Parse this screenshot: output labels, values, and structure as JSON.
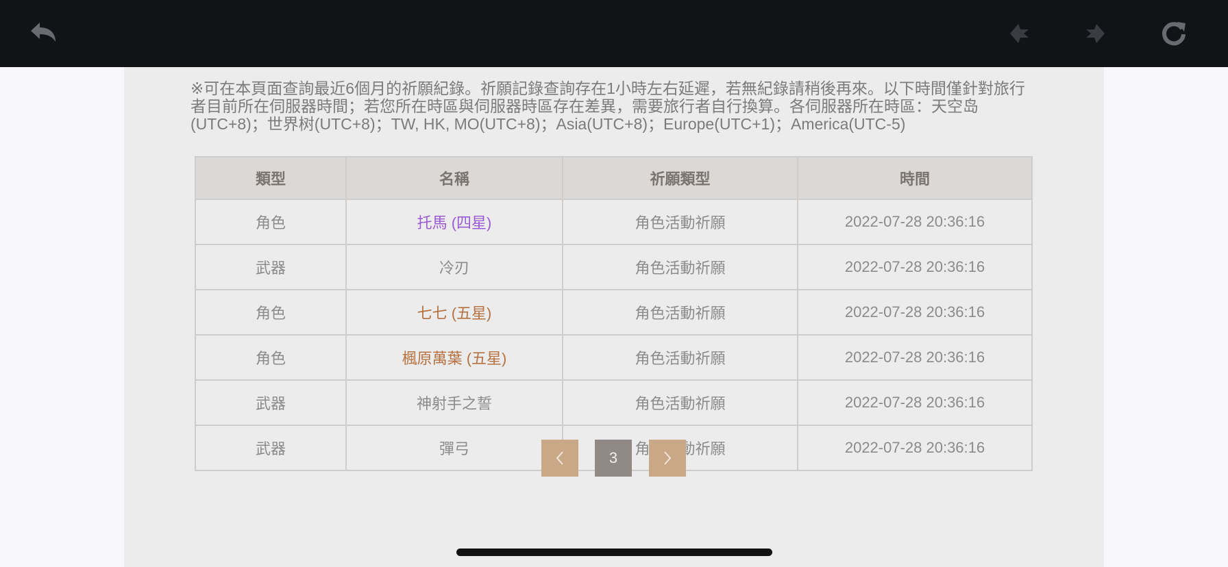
{
  "topbar": {
    "back_icon": "undo-arrow-icon",
    "prev_icon": "diamond-left-icon",
    "next_icon": "diamond-right-icon",
    "refresh_icon": "refresh-icon"
  },
  "notice": "※可在本頁面查詢最近6個月的祈願紀錄。祈願記錄查詢存在1小時左右延遲，若無紀錄請稍後再來。以下時間僅針對旅行者目前所在伺服器時間；若您所在時區與伺服器時區存在差異，需要旅行者自行換算。各伺服器所在時區：天空岛(UTC+8)；世界树(UTC+8)；TW, HK, MO(UTC+8)；Asia(UTC+8)；Europe(UTC+1)；America(UTC-5)",
  "table": {
    "headers": [
      "類型",
      "名稱",
      "祈願類型",
      "時間"
    ],
    "rows": [
      {
        "type": "角色",
        "name": "托馬 (四星)",
        "wish": "角色活動祈願",
        "time": "2022-07-28 20:36:16"
      },
      {
        "type": "武器",
        "name": "冷刃",
        "wish": "角色活動祈願",
        "time": "2022-07-28 20:36:16"
      },
      {
        "type": "角色",
        "name": "七七 (五星)",
        "wish": "角色活動祈願",
        "time": "2022-07-28 20:36:16"
      },
      {
        "type": "角色",
        "name": "楓原萬葉 (五星)",
        "wish": "角色活動祈願",
        "time": "2022-07-28 20:36:16"
      },
      {
        "type": "武器",
        "name": "神射手之誓",
        "wish": "角色活動祈願",
        "time": "2022-07-28 20:36:16"
      },
      {
        "type": "武器",
        "name": "彈弓",
        "wish": "角色活動祈願",
        "time": "2022-07-28 20:36:16"
      }
    ]
  },
  "colors": {
    "four_star": "#9a5ad4",
    "five_star": "#b5713f",
    "pager_arrow": "#c9a887",
    "pager_current": "#918985"
  },
  "pagination": {
    "current_page": "3",
    "prev_icon": "chevron-left-icon",
    "next_icon": "chevron-right-icon"
  }
}
